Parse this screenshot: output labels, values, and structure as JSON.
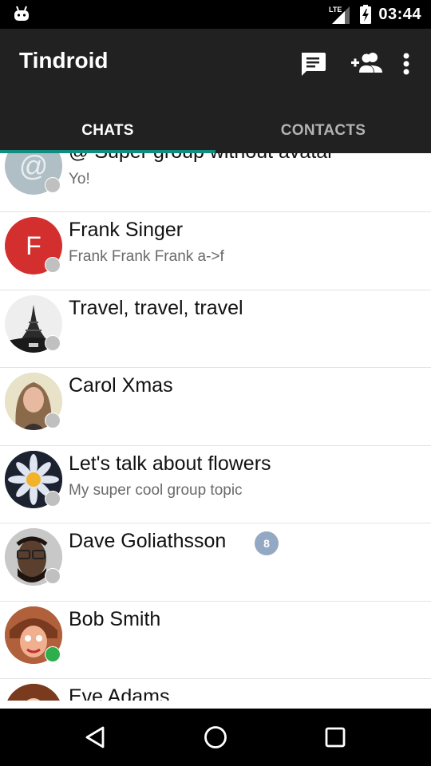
{
  "status_bar": {
    "notification_icon": "android-icon",
    "network": "LTE",
    "time": "03:44"
  },
  "app_bar": {
    "title": "Tindroid",
    "actions": [
      {
        "name": "new-chat",
        "icon": "chat-icon"
      },
      {
        "name": "add-contact",
        "icon": "add-group-icon"
      },
      {
        "name": "more",
        "icon": "more-vert-icon"
      }
    ]
  },
  "tabs": [
    {
      "label": "CHATS",
      "active": true
    },
    {
      "label": "CONTACTS",
      "active": false
    }
  ],
  "accent_color": "#128C7E",
  "chats": [
    {
      "name": "@ Super group without avatar",
      "subtitle": "Yo!",
      "avatar": "at-placeholder",
      "online": false,
      "unread": null
    },
    {
      "name": "Frank Singer",
      "subtitle": "Frank Frank Frank a->f",
      "avatar": "letter-F",
      "avatar_letter": "F",
      "online": false,
      "unread": null
    },
    {
      "name": "Travel, travel, travel",
      "subtitle": "",
      "avatar": "eiffel-tower-photo",
      "online": false,
      "unread": null
    },
    {
      "name": "Carol Xmas",
      "subtitle": "",
      "avatar": "carol-photo",
      "online": false,
      "unread": null
    },
    {
      "name": "Let's talk about flowers",
      "subtitle": "My super cool group topic",
      "avatar": "flower-photo",
      "online": false,
      "unread": null
    },
    {
      "name": "Dave Goliathsson",
      "subtitle": "",
      "avatar": "dave-photo",
      "online": false,
      "unread": "8"
    },
    {
      "name": "Bob Smith",
      "subtitle": "",
      "avatar": "bob-photo",
      "online": true,
      "unread": null
    },
    {
      "name": "Eve Adams",
      "subtitle": "",
      "avatar": "eve-photo",
      "online": false,
      "unread": null
    }
  ],
  "nav_bar": [
    "back",
    "home",
    "recents"
  ]
}
